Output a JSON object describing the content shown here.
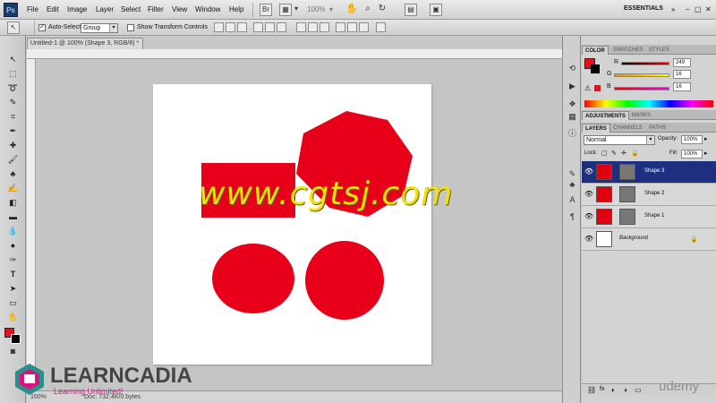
{
  "menubar": {
    "app_logo": "Ps",
    "menus": [
      "File",
      "Edit",
      "Image",
      "Layer",
      "Select",
      "Filter",
      "View",
      "Window",
      "Help"
    ],
    "zoom": "100%",
    "workspace": "ESSENTIALS"
  },
  "options": {
    "auto_select_label": "Auto-Select:",
    "auto_select_value": "Group",
    "show_transform_label": "Show Transform Controls"
  },
  "document": {
    "tab_title": "Untitled-1 @ 100% (Shape 3, RGB/8) *",
    "status": "Doc: 732.4K/0 bytes"
  },
  "panels": {
    "color_tabs": [
      "COLOR",
      "SWATCHES",
      "STYLES"
    ],
    "color": {
      "r_label": "R",
      "g_label": "G",
      "b_label": "B",
      "r": "249",
      "g": "16",
      "b": "16",
      "foreground": "#e8101a"
    },
    "adjust_tabs": [
      "ADJUSTMENTS",
      "MASKS"
    ],
    "layers_tabs": [
      "LAYERS",
      "CHANNELS",
      "PATHS"
    ],
    "blend_mode": "Normal",
    "opacity_label": "Opacity:",
    "opacity": "100%",
    "lock_label": "Lock:",
    "fill_label": "Fill:",
    "fill": "100%",
    "layers": [
      {
        "name": "Shape 3",
        "active": true
      },
      {
        "name": "Shape 2",
        "active": false
      },
      {
        "name": "Shape 1",
        "active": false
      },
      {
        "name": "Background",
        "active": false
      }
    ]
  },
  "overlays": {
    "cgtsj": "www.cgtsj.com",
    "brand": "LEARNCADIA",
    "brand_tagline": "Learning Unlimited!",
    "udemy": "udemy"
  },
  "colors": {
    "shape_red": "#e8001a",
    "layer_active": "#1e2f80"
  }
}
